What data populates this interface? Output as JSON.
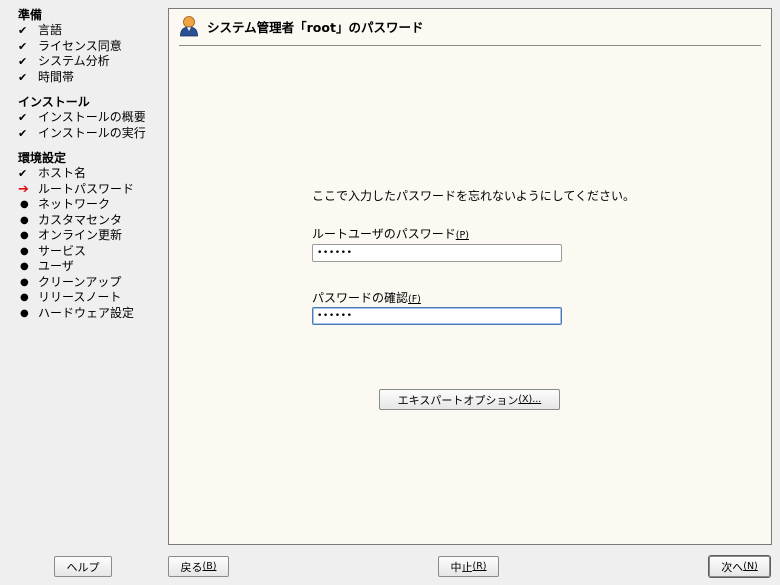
{
  "sidebar": {
    "sections": [
      {
        "title": "準備",
        "items": [
          {
            "icon": "check",
            "label": "言語"
          },
          {
            "icon": "check",
            "label": "ライセンス同意"
          },
          {
            "icon": "check",
            "label": "システム分析"
          },
          {
            "icon": "check",
            "label": "時間帯"
          }
        ]
      },
      {
        "title": "インストール",
        "items": [
          {
            "icon": "check",
            "label": "インストールの概要"
          },
          {
            "icon": "check",
            "label": "インストールの実行"
          }
        ]
      },
      {
        "title": "環境設定",
        "items": [
          {
            "icon": "check",
            "label": "ホスト名"
          },
          {
            "icon": "arrow",
            "label": "ルートパスワード"
          },
          {
            "icon": "dot",
            "label": "ネットワーク"
          },
          {
            "icon": "dot",
            "label": "カスタマセンタ"
          },
          {
            "icon": "dot",
            "label": "オンライン更新"
          },
          {
            "icon": "dot",
            "label": "サービス"
          },
          {
            "icon": "dot",
            "label": "ユーザ"
          },
          {
            "icon": "dot",
            "label": "クリーンアップ"
          },
          {
            "icon": "dot",
            "label": "リリースノート"
          },
          {
            "icon": "dot",
            "label": "ハードウェア設定"
          }
        ]
      }
    ]
  },
  "panel": {
    "title": "システム管理者「root」のパスワード",
    "icon": "user-icon",
    "note": "ここで入力したパスワードを忘れないようにしてください。",
    "password_label": "ルートユーザのパスワード",
    "password_mnemonic": "(P)",
    "password_value": "••••••",
    "confirm_label": "パスワードの確認",
    "confirm_mnemonic": "(F)",
    "confirm_value": "••••••",
    "expert_label": "エキスパートオプション",
    "expert_mnemonic": "(X)..."
  },
  "buttons": {
    "help": "ヘルプ",
    "back": "戻る",
    "back_mnemonic": "(B)",
    "abort": "中止",
    "abort_mnemonic": "(R)",
    "next": "次へ",
    "next_mnemonic": "(N)"
  },
  "colors": {
    "current_step_arrow": "#e0101a",
    "panel_background": "#fbf9f2",
    "window_background": "#efefef"
  }
}
